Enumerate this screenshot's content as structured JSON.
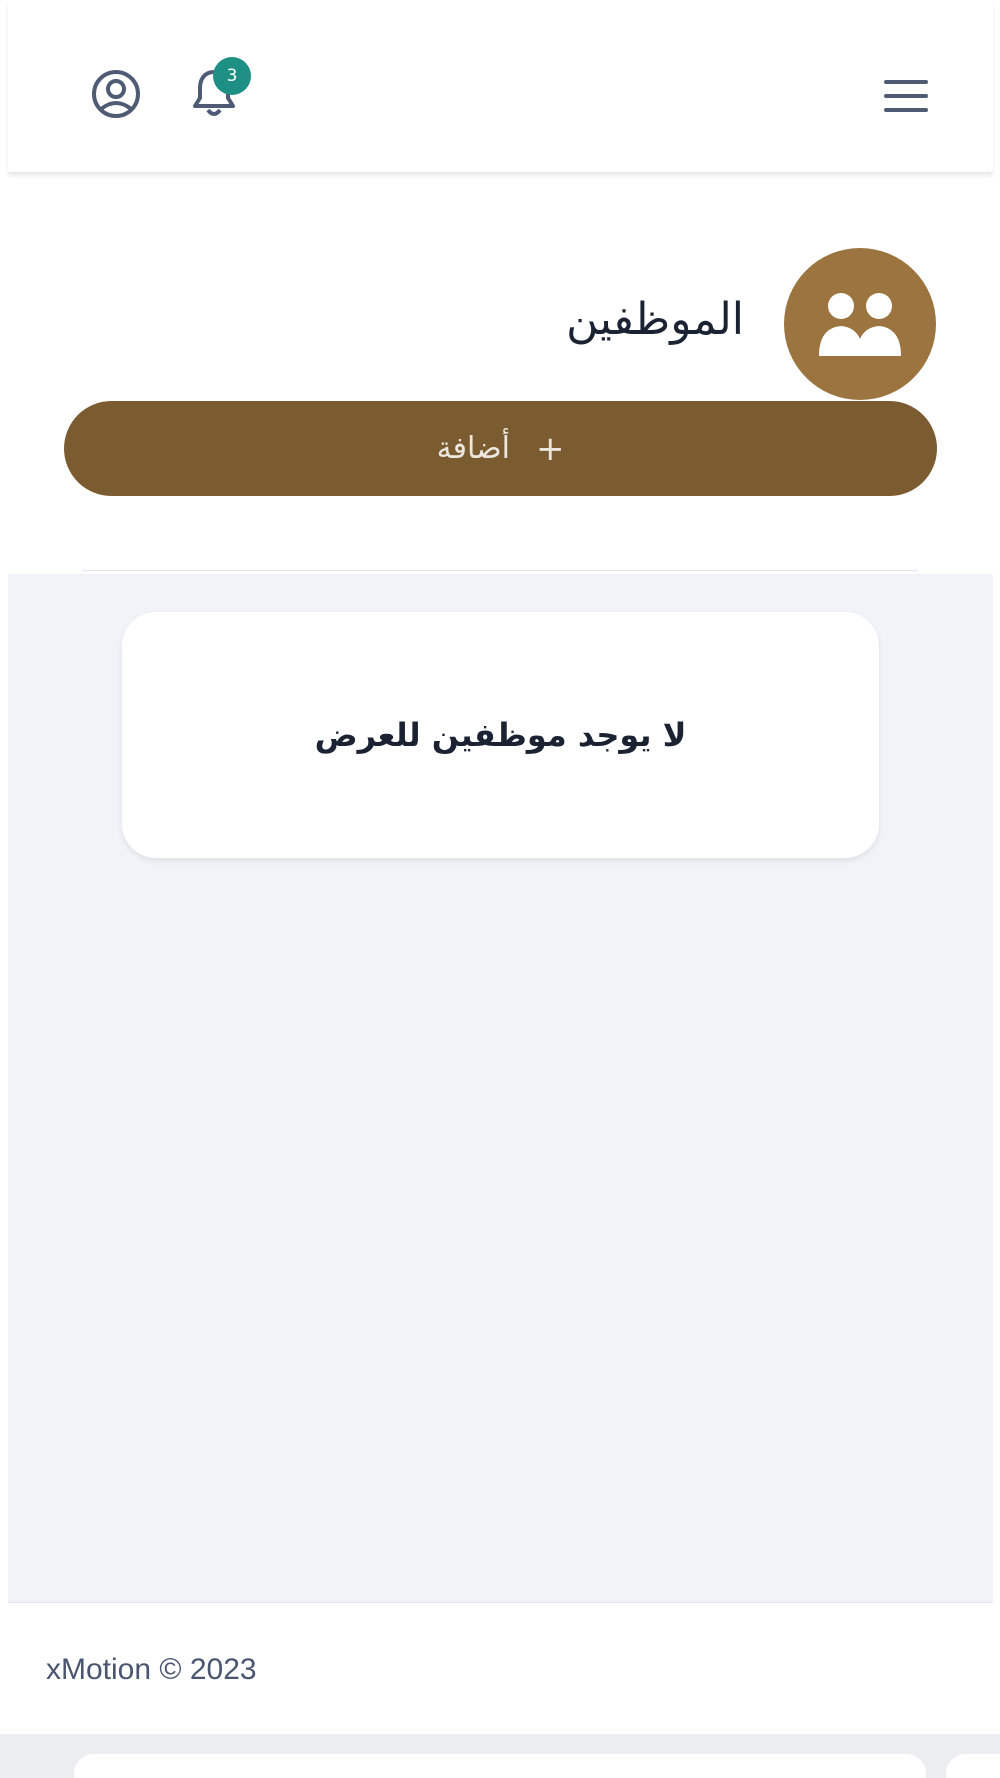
{
  "header": {
    "menu_icon": "hamburger-menu-icon",
    "user_icon": "user-circle-icon",
    "bell_icon": "bell-icon",
    "notification_count": "3",
    "badge_color": "#1e8f84"
  },
  "section": {
    "title": "الموظفين",
    "avatar_icon": "users-icon",
    "accent_color": "#9b7440"
  },
  "add_button": {
    "label": "أضافة",
    "plus": "+",
    "color": "#7b5c31"
  },
  "empty_state": {
    "message": "لا يوجد موظفين للعرض"
  },
  "footer": {
    "text": "xMotion © 2023"
  }
}
